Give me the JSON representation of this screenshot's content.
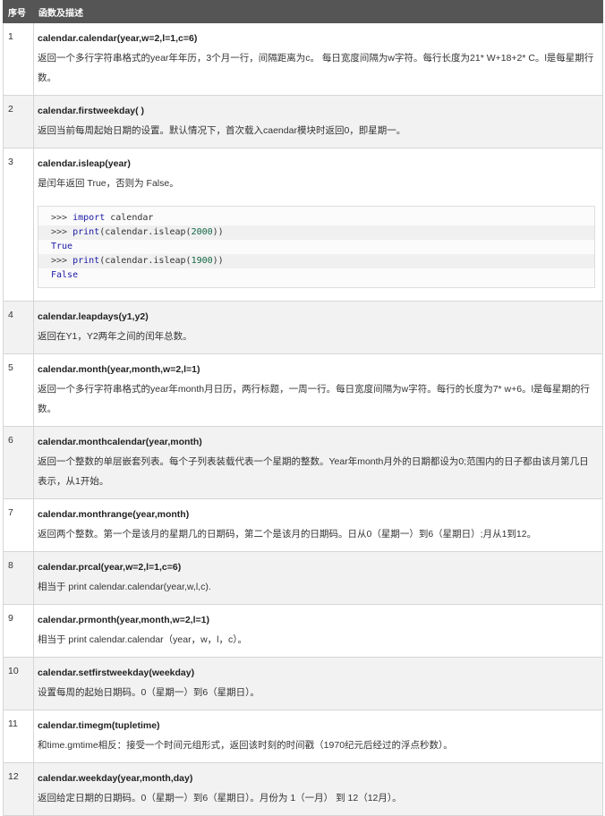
{
  "table": {
    "headers": [
      "序号",
      "函数及描述"
    ],
    "rows": [
      {
        "num": "1",
        "func": "calendar.calendar(year,w=2,l=1,c=6)",
        "desc": "返回一个多行字符串格式的year年年历，3个月一行，间隔距离为c。 每日宽度间隔为w字符。每行长度为21* W+18+2* C。l是每星期行数。"
      },
      {
        "num": "2",
        "func": "calendar.firstweekday( )",
        "desc": "返回当前每周起始日期的设置。默认情况下，首次载入caendar模块时返回0，即星期一。"
      },
      {
        "num": "3",
        "func": "calendar.isleap(year)",
        "desc": "是闰年返回 True，否则为 False。",
        "code": [
          {
            "prompt": ">>> ",
            "kw": "import",
            "rest": " calendar",
            "numlit": "",
            "tail": "",
            "output": false
          },
          {
            "prompt": ">>> ",
            "kw": "print",
            "rest": "(calendar.isleap(",
            "numlit": "2000",
            "tail": "))",
            "output": false
          },
          {
            "prompt": "",
            "kw": "True",
            "rest": "",
            "numlit": "",
            "tail": "",
            "output": true
          },
          {
            "prompt": ">>> ",
            "kw": "print",
            "rest": "(calendar.isleap(",
            "numlit": "1900",
            "tail": "))",
            "output": false
          },
          {
            "prompt": "",
            "kw": "False",
            "rest": "",
            "numlit": "",
            "tail": "",
            "output": true
          }
        ]
      },
      {
        "num": "4",
        "func": "calendar.leapdays(y1,y2)",
        "desc": "返回在Y1，Y2两年之间的闰年总数。"
      },
      {
        "num": "5",
        "func": "calendar.month(year,month,w=2,l=1)",
        "desc": "返回一个多行字符串格式的year年month月日历，两行标题，一周一行。每日宽度间隔为w字符。每行的长度为7* w+6。l是每星期的行数。"
      },
      {
        "num": "6",
        "func": "calendar.monthcalendar(year,month)",
        "desc": "返回一个整数的单层嵌套列表。每个子列表装载代表一个星期的整数。Year年month月外的日期都设为0;范围内的日子都由该月第几日表示，从1开始。"
      },
      {
        "num": "7",
        "func": "calendar.monthrange(year,month)",
        "desc": "返回两个整数。第一个是该月的星期几的日期码，第二个是该月的日期码。日从0（星期一）到6（星期日）;月从1到12。"
      },
      {
        "num": "8",
        "func": "calendar.prcal(year,w=2,l=1,c=6)",
        "desc": "相当于 print calendar.calendar(year,w,l,c)."
      },
      {
        "num": "9",
        "func": "calendar.prmonth(year,month,w=2,l=1)",
        "desc": "相当于 print calendar.calendar（year，w，l，c）。"
      },
      {
        "num": "10",
        "func": "calendar.setfirstweekday(weekday)",
        "desc": "设置每周的起始日期码。0（星期一）到6（星期日）。"
      },
      {
        "num": "11",
        "func": "calendar.timegm(tupletime)",
        "desc": "和time.gmtime相反：接受一个时间元组形式，返回该时刻的时间戳（1970纪元后经过的浮点秒数）。"
      },
      {
        "num": "12",
        "func": "calendar.weekday(year,month,day)",
        "desc": "返回给定日期的日期码。0（星期一）到6（星期日）。月份为 1（一月） 到 12（12月）。"
      }
    ]
  }
}
